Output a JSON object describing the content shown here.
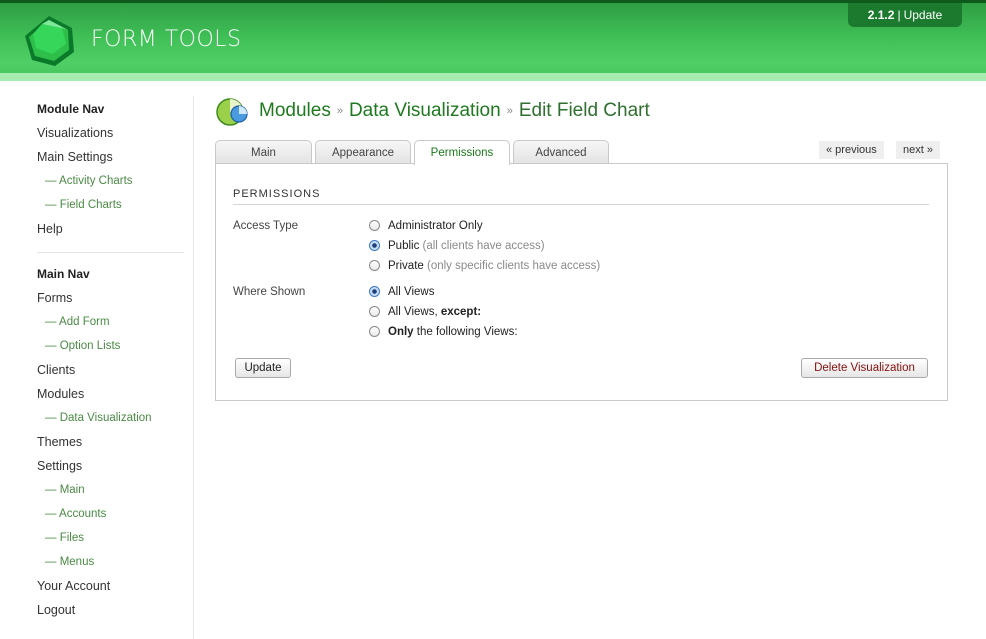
{
  "header": {
    "logo_text": "FORM TOOLS",
    "version": "2.1.2",
    "version_sep": "|",
    "update_label": "Update"
  },
  "sidebar": {
    "module_nav_heading": "Module Nav",
    "module_items": [
      {
        "label": "Visualizations"
      },
      {
        "label": "Main Settings"
      },
      {
        "label": "— Activity Charts"
      },
      {
        "label": "— Field Charts"
      },
      {
        "label": "Help"
      }
    ],
    "main_nav_heading": "Main Nav",
    "main_items": [
      {
        "label": "Forms"
      },
      {
        "label": "— Add Form"
      },
      {
        "label": "— Option Lists"
      },
      {
        "label": "Clients"
      },
      {
        "label": "Modules"
      },
      {
        "label": "— Data Visualization"
      },
      {
        "label": "Themes"
      },
      {
        "label": "Settings"
      },
      {
        "label": "— Main"
      },
      {
        "label": "— Accounts"
      },
      {
        "label": "— Files"
      },
      {
        "label": "— Menus"
      },
      {
        "label": "Your Account"
      },
      {
        "label": "Logout"
      }
    ]
  },
  "breadcrumb": {
    "modules": "Modules",
    "separator": "»",
    "data_visualization": "Data Visualization",
    "current": "Edit Field Chart"
  },
  "tabs": [
    {
      "label": "Main"
    },
    {
      "label": "Appearance"
    },
    {
      "label": "Permissions"
    },
    {
      "label": "Advanced"
    }
  ],
  "pager": {
    "previous": "« previous",
    "next": "next »"
  },
  "permissions": {
    "section_title": "PERMISSIONS",
    "access_type_label": "Access Type",
    "access_options": [
      {
        "label": "Administrator Only",
        "hint": "",
        "checked": false
      },
      {
        "label": "Public",
        "hint": "(all clients have access)",
        "checked": true
      },
      {
        "label": "Private",
        "hint": "(only specific clients have access)",
        "checked": false
      }
    ],
    "where_shown_label": "Where Shown",
    "where_options": [
      {
        "pre": "",
        "bold": "",
        "label": "All Views",
        "checked": true
      },
      {
        "pre": "All Views, ",
        "bold": "except:",
        "label": "",
        "checked": false
      },
      {
        "pre": "",
        "bold": "Only",
        "label": " the following Views:",
        "checked": false
      }
    ],
    "update_button": "Update",
    "delete_button": "Delete Visualization"
  },
  "colors": {
    "header_green": "#3fbf56",
    "header_dark": "#0d5a1c",
    "link_green": "#1f7a1f",
    "sub_link_green": "#4a8a44"
  }
}
